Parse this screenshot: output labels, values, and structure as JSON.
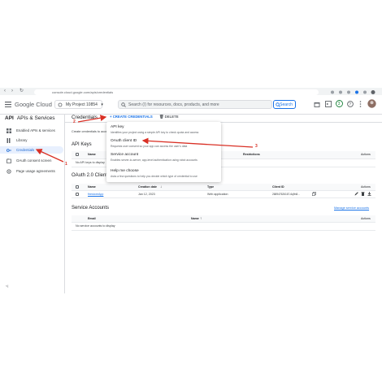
{
  "browser": {
    "url": "console.cloud.google.com/apis/credentials",
    "nav_back": "‹",
    "nav_forward": "›",
    "reload": "↻"
  },
  "header": {
    "logo": "Google Cloud",
    "project": "My Project 10854",
    "search_placeholder": "Search (/) for resources, docs, products, and more",
    "search_button": "Search"
  },
  "sidebar": {
    "title_prefix": "API",
    "title": "APIs & Services",
    "items": [
      {
        "label": "Enabled APIs & services"
      },
      {
        "label": "Library"
      },
      {
        "label": "Credentials"
      },
      {
        "label": "OAuth consent screen"
      },
      {
        "label": "Page usage agreements"
      }
    ],
    "collapse": "<|"
  },
  "toolbar": {
    "heading": "Credentials",
    "create": "CREATE CREDENTIALS",
    "delete": "DELETE"
  },
  "main": {
    "intro": "Create credentials to access your enabled APIs.",
    "api_keys": {
      "title": "API Keys",
      "columns": [
        "Name",
        "Restrictions",
        "Actions"
      ],
      "empty": "No API keys to display"
    },
    "oauth": {
      "title": "OAuth 2.0 Client IDs",
      "columns": [
        "Name",
        "Creation date",
        "Type",
        "Client ID",
        "Actions"
      ],
      "row": {
        "name": "firestoreApp",
        "date": "Jan 12, 2023",
        "type": "Web application",
        "client_id": "268947626167-6q9n8..."
      }
    },
    "service": {
      "title": "Service Accounts",
      "manage": "Manage service accounts",
      "columns": [
        "Email",
        "Name",
        "Actions"
      ],
      "empty": "No service accounts to display"
    }
  },
  "dropdown": {
    "items": [
      {
        "title": "API key",
        "desc": "Identifies your project using a simple API key to check quota and access"
      },
      {
        "title": "OAuth client ID",
        "desc": "Requests user consent so your app can access the user's data"
      },
      {
        "title": "Service account",
        "desc": "Enables server-to-server, app-level authentication using robot accounts"
      },
      {
        "title": "Help me choose",
        "desc": "Asks a few questions to help you decide which type of credential to use"
      }
    ]
  },
  "annotations": {
    "step1": "1",
    "step2": "2",
    "step3": "3"
  },
  "colors": {
    "accent": "#1a73e8",
    "annotation": "#d93025",
    "active_nav_bg": "#e8f0fe"
  }
}
